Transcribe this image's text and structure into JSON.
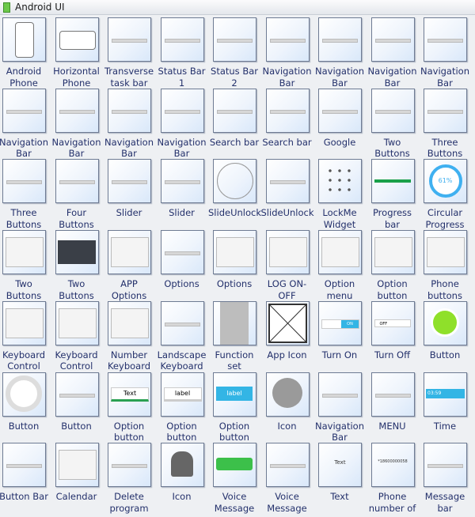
{
  "panel": {
    "title": "Android UI"
  },
  "items": [
    {
      "label": "Android Phone",
      "kind": "phone"
    },
    {
      "label": "Horizontal Phone",
      "kind": "hphone"
    },
    {
      "label": "Transverse task bar",
      "kind": "bar"
    },
    {
      "label": "Status Bar 1",
      "kind": "bar"
    },
    {
      "label": "Status Bar 2",
      "kind": "bar"
    },
    {
      "label": "Navigation Bar",
      "kind": "bar"
    },
    {
      "label": "Navigation Bar",
      "kind": "bar"
    },
    {
      "label": "Navigation Bar",
      "kind": "bar"
    },
    {
      "label": "Navigation Bar",
      "kind": "bar"
    },
    {
      "label": "Navigation Bar",
      "kind": "bar"
    },
    {
      "label": "Navigation Bar",
      "kind": "bar"
    },
    {
      "label": "Navigation Bar",
      "kind": "bar"
    },
    {
      "label": "Navigation Bar",
      "kind": "bar"
    },
    {
      "label": "Search bar",
      "kind": "bar"
    },
    {
      "label": "Search bar",
      "kind": "bar"
    },
    {
      "label": "Google",
      "kind": "bar"
    },
    {
      "label": "Two Buttons",
      "kind": "bar"
    },
    {
      "label": "Three Buttons",
      "kind": "bar"
    },
    {
      "label": "Three Buttons",
      "kind": "bar"
    },
    {
      "label": "Four Buttons",
      "kind": "bar"
    },
    {
      "label": "Slider",
      "kind": "bar"
    },
    {
      "label": "Slider",
      "kind": "bar"
    },
    {
      "label": "SlideUnlock",
      "kind": "circle"
    },
    {
      "label": "SlideUnlock",
      "kind": "bar"
    },
    {
      "label": "LockMe Widget",
      "kind": "dots"
    },
    {
      "label": "Progress bar",
      "kind": "progress"
    },
    {
      "label": "Circular Progress",
      "kind": "ring",
      "text": "61%"
    },
    {
      "label": "Two Buttons",
      "kind": "panel"
    },
    {
      "label": "Two Buttons",
      "kind": "dark"
    },
    {
      "label": "APP Options",
      "kind": "panel"
    },
    {
      "label": "Options",
      "kind": "bar"
    },
    {
      "label": "Options",
      "kind": "panel"
    },
    {
      "label": "LOG ON-OFF",
      "kind": "panel"
    },
    {
      "label": "Option menu",
      "kind": "panel"
    },
    {
      "label": "Option button",
      "kind": "panel"
    },
    {
      "label": "Phone buttons",
      "kind": "panel"
    },
    {
      "label": "Keyboard Control",
      "kind": "panel"
    },
    {
      "label": "Keyboard Control",
      "kind": "panel"
    },
    {
      "label": "Number Keyboard",
      "kind": "panel"
    },
    {
      "label": "Landscape Keyboard",
      "kind": "bar"
    },
    {
      "label": "Function set",
      "kind": "gray"
    },
    {
      "label": "App Icon",
      "kind": "x"
    },
    {
      "label": "Turn On",
      "kind": "toggle-on",
      "text": "ON"
    },
    {
      "label": "Turn Off",
      "kind": "toggle-off",
      "text": "OFF"
    },
    {
      "label": "Button",
      "kind": "green"
    },
    {
      "label": "Button",
      "kind": "white-circle"
    },
    {
      "label": "Button",
      "kind": "bar"
    },
    {
      "label": "Option button",
      "kind": "textbtn",
      "text": "Text"
    },
    {
      "label": "Option button",
      "kind": "textbtn",
      "text": "label"
    },
    {
      "label": "Option button",
      "kind": "bluebtn",
      "text": "label"
    },
    {
      "label": "Icon",
      "kind": "grayicon"
    },
    {
      "label": "Navigation Bar",
      "kind": "bar"
    },
    {
      "label": "MENU",
      "kind": "bar"
    },
    {
      "label": "Time",
      "kind": "time",
      "text": "03:59"
    },
    {
      "label": "Button Bar",
      "kind": "bar"
    },
    {
      "label": "Calendar",
      "kind": "panel"
    },
    {
      "label": "Delete program",
      "kind": "bar"
    },
    {
      "label": "Icon",
      "kind": "android"
    },
    {
      "label": "Voice Message",
      "kind": "voice"
    },
    {
      "label": "Voice Message",
      "kind": "bar"
    },
    {
      "label": "Text",
      "kind": "text",
      "text": "Text"
    },
    {
      "label": "Phone number of",
      "kind": "text",
      "text": "*18600000058"
    },
    {
      "label": "Message bar",
      "kind": "bar"
    }
  ]
}
